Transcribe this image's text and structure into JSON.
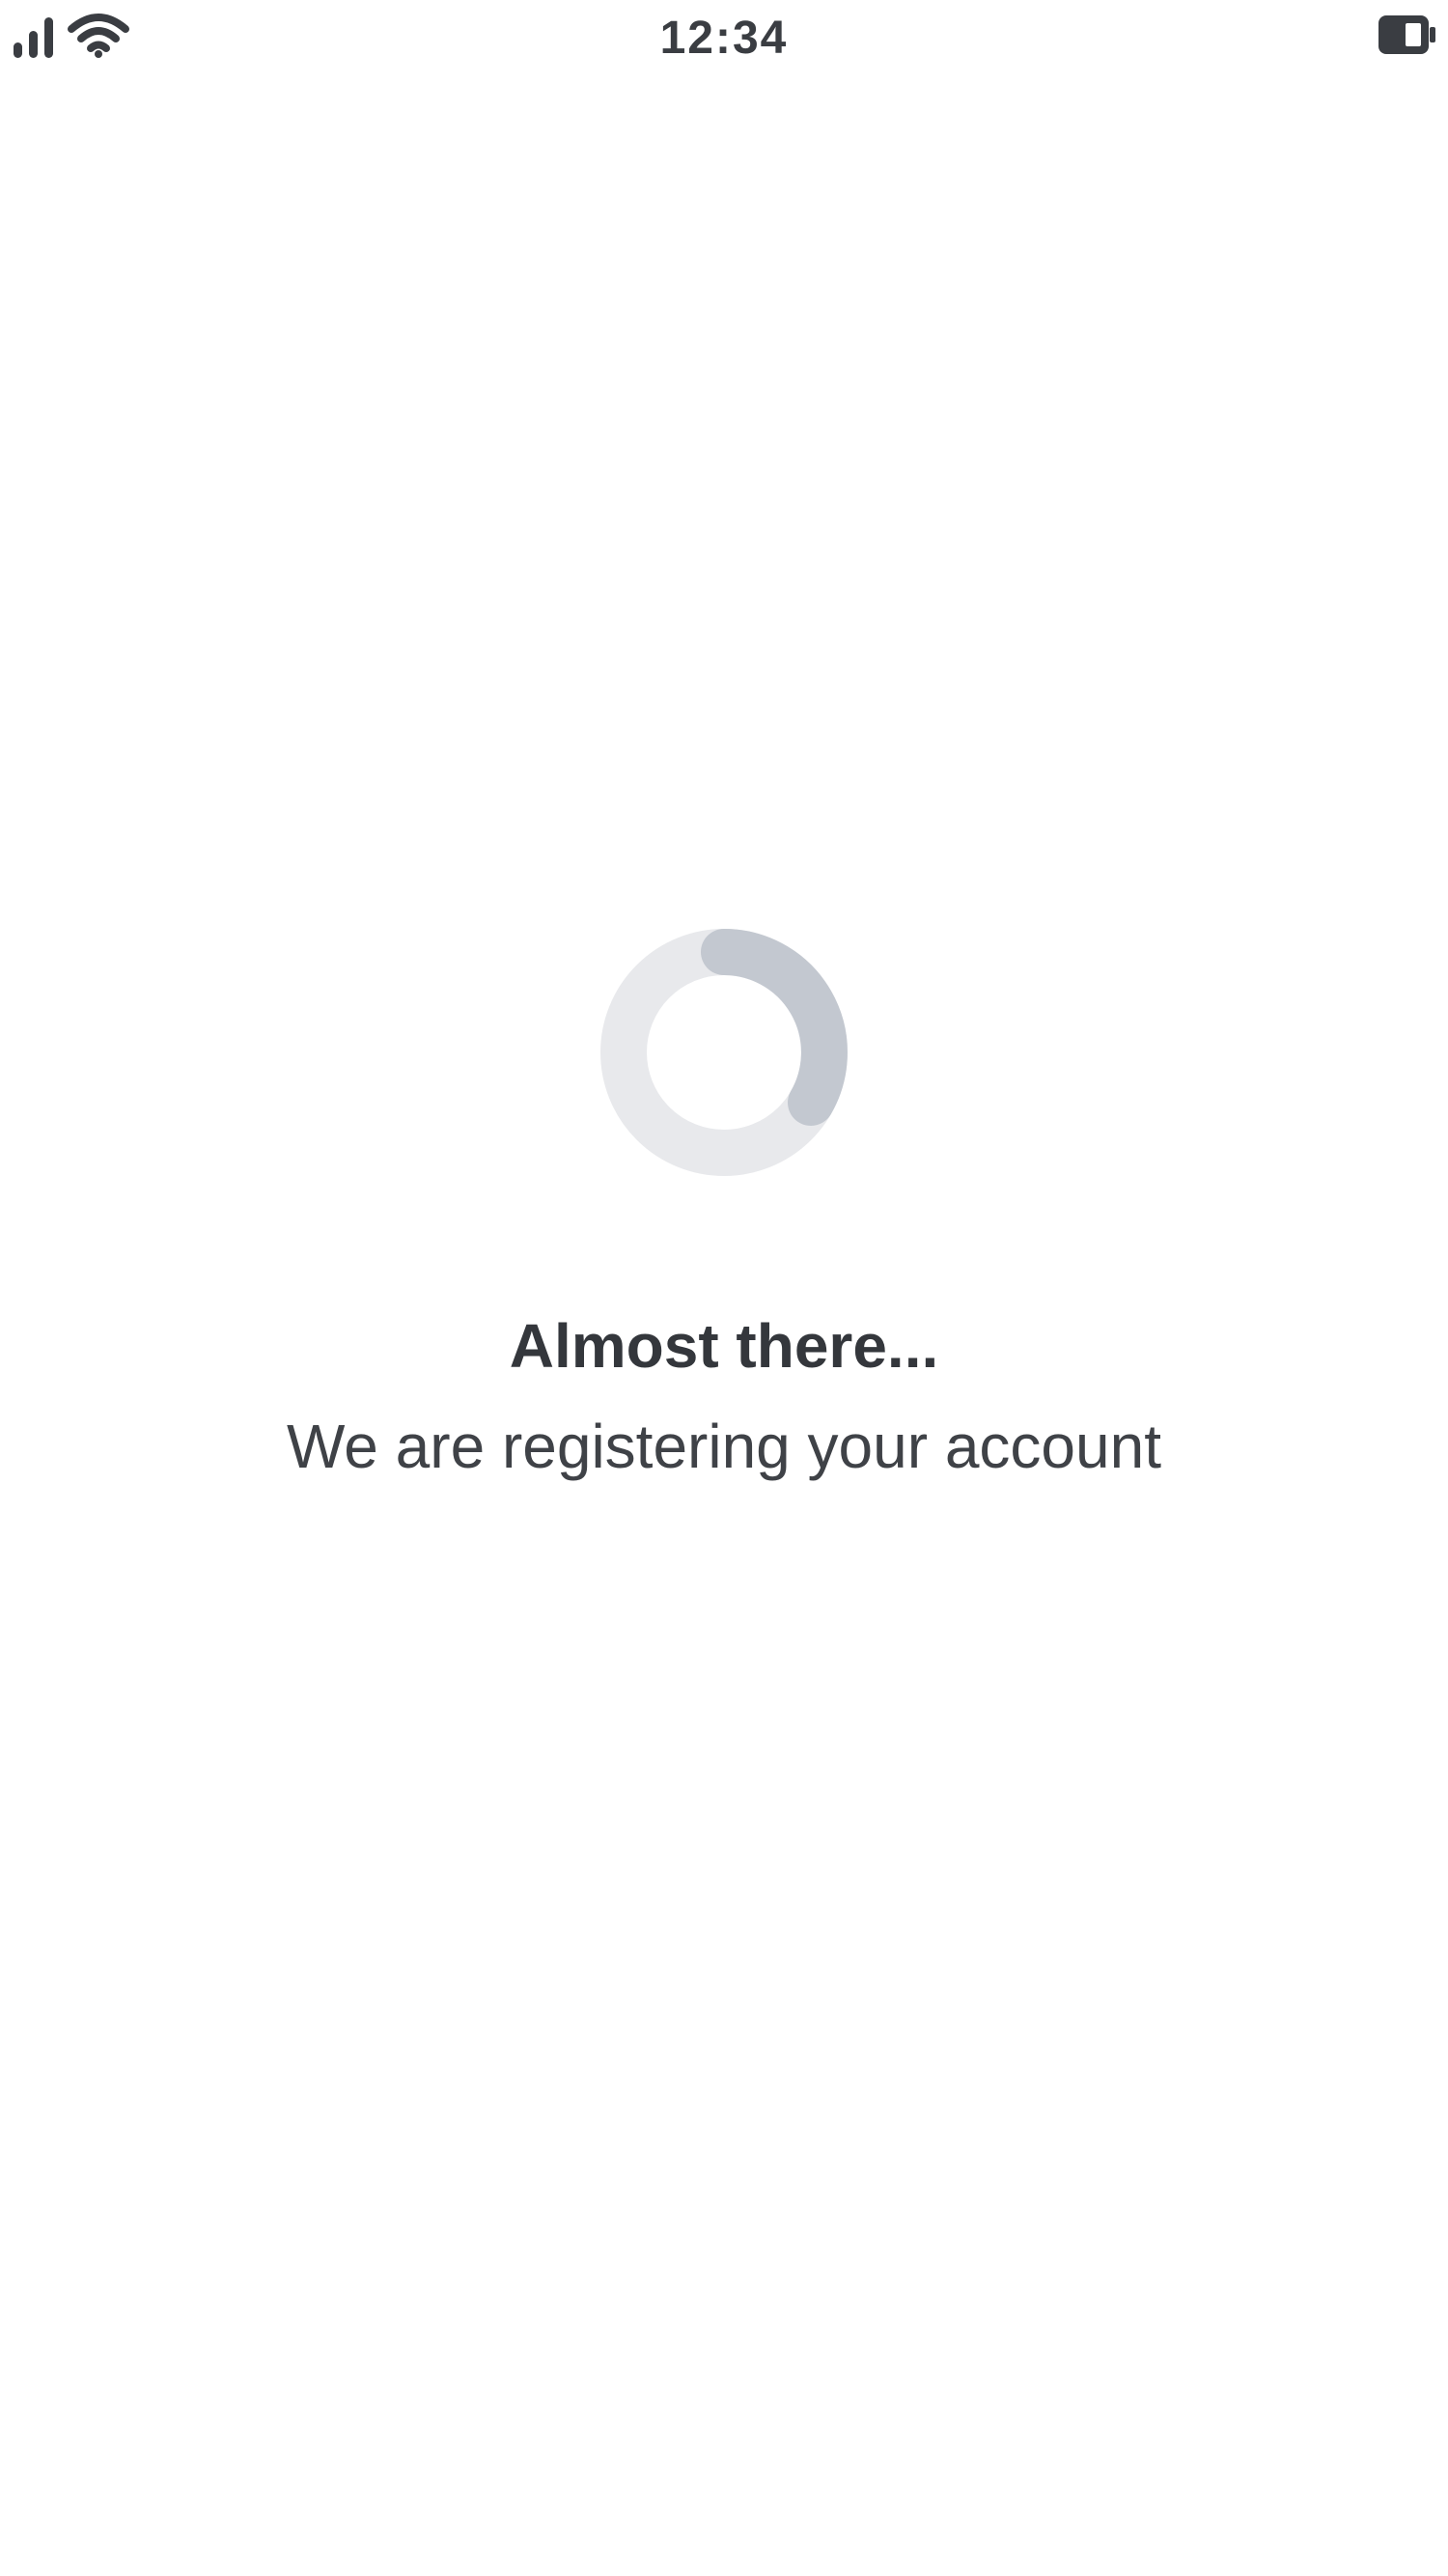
{
  "status_bar": {
    "time": "12:34",
    "icons": [
      "signal-icon",
      "wifi-icon",
      "battery-icon"
    ]
  },
  "loading": {
    "title": "Almost there...",
    "message": "We are registering your account",
    "spinner_track_color": "#e8e9ec",
    "spinner_arc_color": "#c3c8d0"
  }
}
